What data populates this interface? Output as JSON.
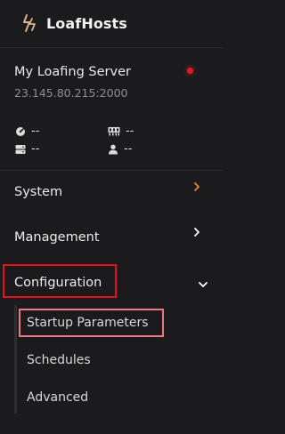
{
  "brand": {
    "name": "LoafHosts",
    "logo_icon": "bolt-logo-icon",
    "logo_color": "#d9b48f"
  },
  "server": {
    "name": "My Loafing Server",
    "address": "23.145.80.215:2000",
    "status_color": "#e0192b"
  },
  "stats": [
    {
      "icon": "gauge-icon",
      "value": "--"
    },
    {
      "icon": "memory-icon",
      "value": "--"
    },
    {
      "icon": "storage-icon",
      "value": "--"
    },
    {
      "icon": "user-icon",
      "value": "--"
    }
  ],
  "nav": {
    "items": [
      {
        "label": "System",
        "chevron": "chevron-right-icon",
        "chevron_color": "#e58a2f"
      },
      {
        "label": "Management",
        "chevron": "chevron-right-icon",
        "chevron_color": "#ffffff"
      },
      {
        "label": "Configuration",
        "chevron": "chevron-down-icon",
        "chevron_color": "#ffffff"
      }
    ],
    "sub_items": [
      {
        "label": "Startup Parameters"
      },
      {
        "label": "Schedules"
      },
      {
        "label": "Advanced"
      }
    ]
  },
  "highlights": {
    "configuration_color": "#e3101f",
    "startup_color": "#f07885"
  }
}
